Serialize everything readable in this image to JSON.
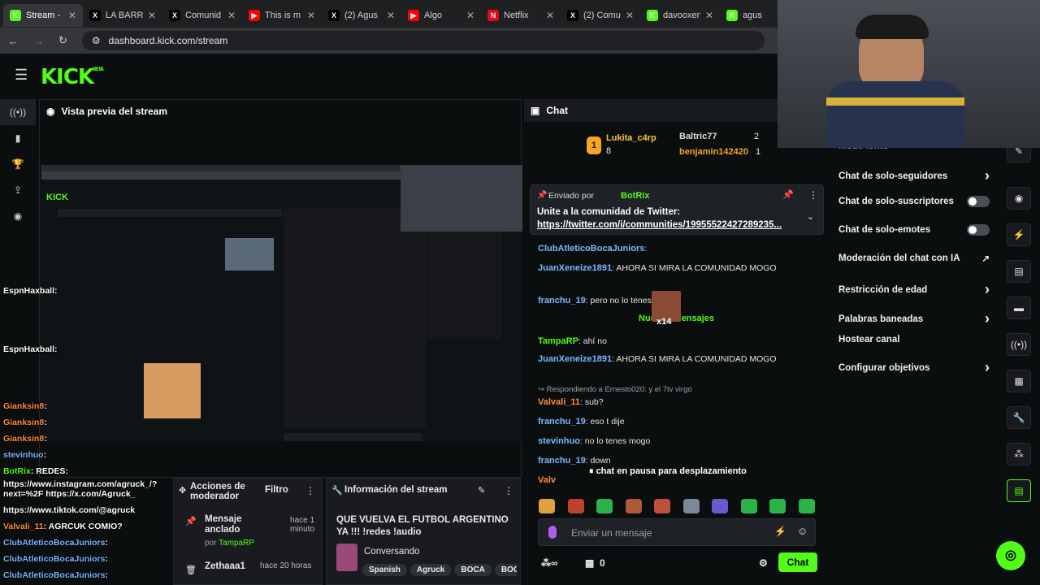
{
  "browser": {
    "tabs": [
      {
        "label": "Stream -",
        "color": "#53fc18",
        "icon": "kick-icon"
      },
      {
        "label": "LA BARR",
        "color": "#000000",
        "icon": "x-icon"
      },
      {
        "label": "Comunid",
        "color": "#000000",
        "icon": "x-icon"
      },
      {
        "label": "This is m",
        "color": "#ff0000",
        "icon": "youtube-icon"
      },
      {
        "label": "(2) Agus",
        "color": "#000000",
        "icon": "x-icon"
      },
      {
        "label": "Algo",
        "color": "#ff0000",
        "icon": "youtube-icon"
      },
      {
        "label": "Netflix",
        "color": "#e50914",
        "icon": "netflix-icon"
      },
      {
        "label": "(2) Comu",
        "color": "#000000",
        "icon": "x-icon"
      },
      {
        "label": "davooxen",
        "color": "#53fc18",
        "icon": "kick-icon"
      },
      {
        "label": "agus",
        "color": "#53fc18",
        "icon": "kick-icon"
      }
    ],
    "url": "dashboard.kick.com/stream"
  },
  "header": {
    "logo": "KICK",
    "beta": "BETA"
  },
  "preview": {
    "title": "Vista previa del stream"
  },
  "chat": {
    "title": "Chat",
    "leaderboard": [
      {
        "rank": "1",
        "name": "Lukita_c4rp",
        "count": "8"
      },
      {
        "name": "Baltric77",
        "count": "2"
      },
      {
        "name": "benjamin142420",
        "count": "1"
      }
    ],
    "pinned": {
      "sent_by": "Enviado por",
      "author": "BotRix",
      "line1": "Unite a la comunidad de Twitter:",
      "line2": "https://twitter.com/i/communities/19955522427289235..."
    },
    "messages": [
      {
        "user": "ClubAtleticoBocaJuniors",
        "text": ":"
      },
      {
        "user": "JuanXeneize1891",
        "text": ": AHORA SI MIRA LA COMUNIDAD MOGO"
      },
      {
        "user": "franchu_19",
        "text": ": pero no lo tenes"
      },
      {
        "user": "TampaRP",
        "text": ": ahí no"
      },
      {
        "user": "JuanXeneize1891",
        "text": ": AHORA SI MIRA LA COMUNIDAD MOGO"
      },
      {
        "user": "Valvali_11",
        "text": ": sub?"
      },
      {
        "user": "franchu_19",
        "text": ": eso t dije"
      },
      {
        "user": "stevinhuo",
        "text": ": no lo tenes mogo"
      },
      {
        "user": "franchu_19",
        "text": ": down"
      },
      {
        "user": "Valv",
        "text": ""
      }
    ],
    "new_messages": "Nuevos mensajes",
    "emote_badge": "x14",
    "reply_to": "Respondiendo a Ernesto020: y el 7tv virgo",
    "paused": "chat en pausa para desplazamiento",
    "input_placeholder": "Enviar un mensaje",
    "count": "0",
    "send_label": "Chat"
  },
  "settings": {
    "partial": "Modo lento",
    "items": [
      {
        "label": "Chat de solo-seguidores",
        "kind": "arrow"
      },
      {
        "label": "Chat de solo-suscriptores",
        "kind": "toggle"
      },
      {
        "label": "Chat de solo-emotes",
        "kind": "toggle"
      },
      {
        "label": "Moderación del chat con IA",
        "kind": "external"
      },
      {
        "label": "Restricción de edad",
        "kind": "arrow"
      },
      {
        "label": "Palabras baneadas",
        "kind": "arrow"
      },
      {
        "label": "Hostear canal",
        "kind": "none"
      },
      {
        "label": "Configurar objetivos",
        "kind": "arrow"
      }
    ]
  },
  "modactions": {
    "title": "Acciones de moderador",
    "filter": "Filtro",
    "rows": [
      {
        "title": "Mensaje anclado",
        "by": "por",
        "user": "TampaRP",
        "time": "hace 1 minuto"
      },
      {
        "title": "Zethaaa1",
        "time": "hace 20 horas"
      }
    ]
  },
  "streaminfo": {
    "title": "Información del stream",
    "stream_title": "QUE VUELVA EL FUTBOL ARGENTINO YA !!! !redes !audio",
    "category": "Conversando",
    "tags": [
      "Spanish",
      "Agruck",
      "BOCA",
      "BOC"
    ]
  },
  "overlay_chat": [
    {
      "user": "EspnHaxball",
      "text": ":"
    },
    {
      "user": "EspnHaxball",
      "text": ":"
    },
    {
      "user": "Gianksin8",
      "text": ":"
    },
    {
      "user": "Gianksin8",
      "text": ":"
    },
    {
      "user": "Gianksin8",
      "text": ":"
    },
    {
      "user": "stevinhuo",
      "text": ":"
    },
    {
      "user": "BotRix",
      "text": ": REDES:"
    },
    {
      "user": "",
      "text": "https://www.instagram.com/agruck_/?next=%2F https://x.com/Agruck_"
    },
    {
      "user": "",
      "text": "https://www.tiktok.com/@agruck"
    },
    {
      "user": "Valvali_11",
      "text": ": AGRCUK COMIO?"
    },
    {
      "user": "ClubAtleticoBocaJuniors",
      "text": ":"
    },
    {
      "user": "ClubAtleticoBocaJuniors",
      "text": ":"
    },
    {
      "user": "ClubAtleticoBocaJuniors",
      "text": ":"
    }
  ]
}
